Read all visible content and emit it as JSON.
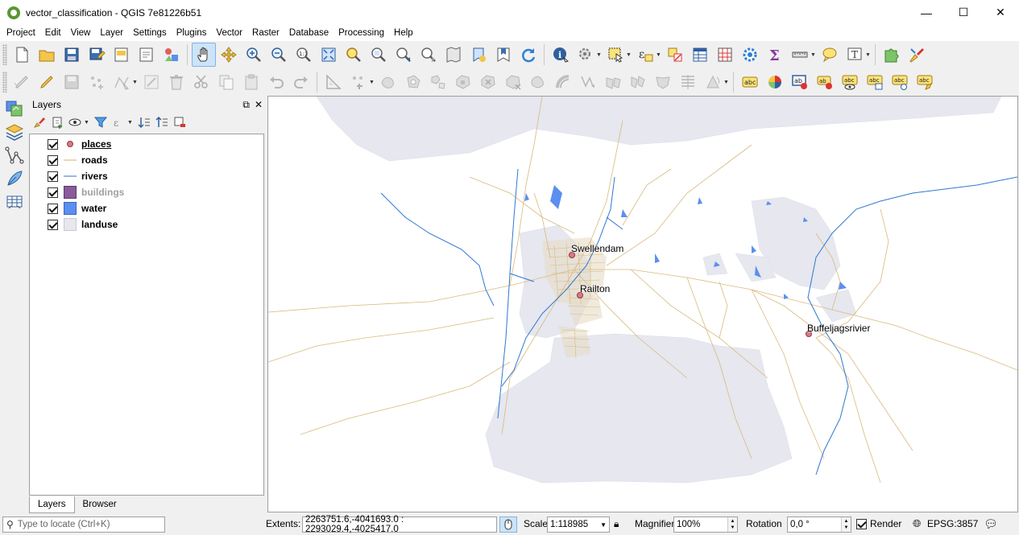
{
  "window": {
    "title": "vector_classification - QGIS 7e81226b51",
    "minimize": "—",
    "maximize": "☐",
    "close": "✕"
  },
  "menu": [
    "Project",
    "Edit",
    "View",
    "Layer",
    "Settings",
    "Plugins",
    "Vector",
    "Raster",
    "Database",
    "Processing",
    "Help"
  ],
  "layers_panel": {
    "title": "Layers",
    "layers": [
      {
        "name": "places",
        "symbol": "point",
        "color": "#e07783",
        "checked": true,
        "underlined": true
      },
      {
        "name": "roads",
        "symbol": "line",
        "color": "#d2b06f",
        "checked": true
      },
      {
        "name": "rivers",
        "symbol": "line",
        "color": "#2e6fc0",
        "checked": true
      },
      {
        "name": "buildings",
        "symbol": "fill",
        "color": "#8a5a9b",
        "checked": true,
        "greyed": true
      },
      {
        "name": "water",
        "symbol": "fill",
        "color": "#5b8ff0",
        "checked": true
      },
      {
        "name": "landuse",
        "symbol": "fill",
        "color": "#e6e7ef",
        "checked": true
      }
    ],
    "tabs": [
      "Layers",
      "Browser"
    ]
  },
  "map": {
    "labels": [
      "Swellendam",
      "Railton",
      "Buffeljagsrivier"
    ],
    "colors": {
      "landuse": "#e6e7ef",
      "roads": "#d9b97c",
      "rivers": "#2e78d0",
      "water": "#5b8ff0",
      "places": "#e07783"
    }
  },
  "statusbar": {
    "locator_placeholder": "Type to locate (Ctrl+K)",
    "extents_label": "Extents:",
    "extents_value": "2263751.6,-4041693.0 : 2293029.4,-4025417.0",
    "scale_label": "Scale",
    "scale_value": "1:118985",
    "magnifier_label": "Magnifier",
    "magnifier_value": "100%",
    "rotation_label": "Rotation",
    "rotation_value": "0,0 °",
    "render_label": "Render",
    "crs": "EPSG:3857"
  }
}
